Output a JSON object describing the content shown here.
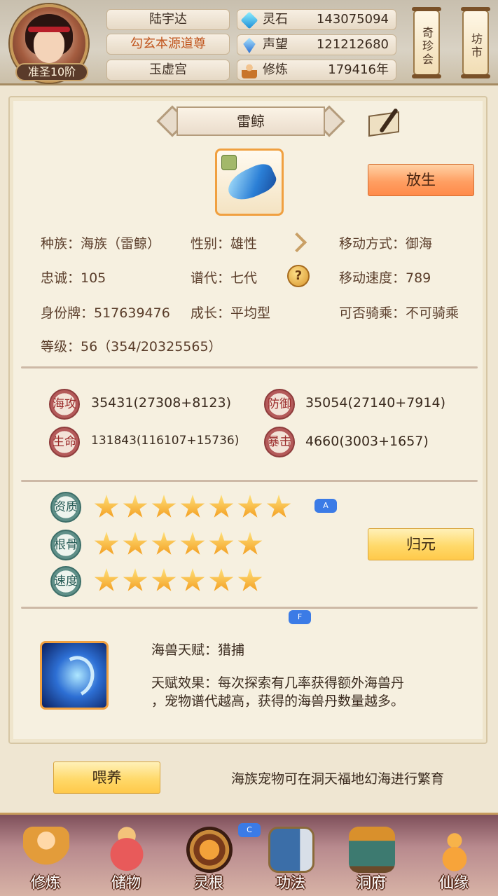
{
  "player": {
    "rank": "准圣10阶",
    "name": "陆宇达",
    "title": "勾玄本源道尊",
    "sect": "玉虚宫"
  },
  "resources": [
    {
      "icon": "spirit-stone-icon",
      "label": "灵石",
      "value": "143075094"
    },
    {
      "icon": "reputation-crystal-icon",
      "label": "声望",
      "value": "121212680"
    },
    {
      "icon": "cultivation-icon",
      "label": "修炼",
      "value": "179416年"
    }
  ],
  "top_buttons": {
    "treasure": "奇珍会",
    "market": "坊市"
  },
  "pet": {
    "name": "雷鲸",
    "release_label": "放生",
    "race": "种族：海族（雷鲸）",
    "gender": "性别：雄性",
    "move_type": "移动方式：御海",
    "loyalty": "忠诚：105",
    "generation": "谱代：七代",
    "move_speed": "移动速度：789",
    "id_tag": "身份牌：517639476",
    "growth": "成长：平均型",
    "rideable": "可否骑乘：不可骑乘",
    "level": "等级：56（354/20325565）"
  },
  "stats": [
    {
      "label": "海攻",
      "value": "35431(27308+8123)"
    },
    {
      "label": "防御",
      "value": "35054(27140+7914)"
    },
    {
      "label": "生命",
      "value": "131843(116107+15736)"
    },
    {
      "label": "暴击",
      "value": "4660(3003+1657)"
    }
  ],
  "qualities": [
    {
      "label": "资质",
      "stars": 7
    },
    {
      "label": "根骨",
      "stars": 6
    },
    {
      "label": "速度",
      "stars": 6
    }
  ],
  "return_label": "归元",
  "talent": {
    "name": "海兽天赋：猎捕",
    "effect_line1": "天赋效果：每次探索有几率获得额外海兽丹",
    "effect_line2": "，宠物谱代越高，获得的海兽丹数量越多。"
  },
  "feed_label": "喂养",
  "bottom_note": "海族宠物可在洞天福地幻海进行繁育",
  "nav": [
    {
      "icon": "monk-icon",
      "label": "修炼"
    },
    {
      "icon": "bag-icon",
      "label": "储物"
    },
    {
      "icon": "spirit-root-icon",
      "label": "灵根"
    },
    {
      "icon": "book-icon",
      "label": "功法"
    },
    {
      "icon": "cave-house-icon",
      "label": "洞府"
    },
    {
      "icon": "gourd-icon",
      "label": "仙缘"
    }
  ],
  "overlay_tags": [
    "A",
    "F",
    "C"
  ]
}
